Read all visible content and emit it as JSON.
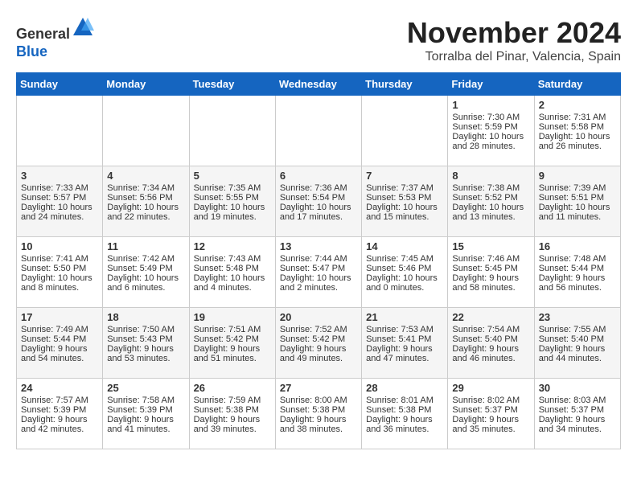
{
  "header": {
    "logo_line1": "General",
    "logo_line2": "Blue",
    "month_title": "November 2024",
    "location": "Torralba del Pinar, Valencia, Spain"
  },
  "weekdays": [
    "Sunday",
    "Monday",
    "Tuesday",
    "Wednesday",
    "Thursday",
    "Friday",
    "Saturday"
  ],
  "weeks": [
    [
      {
        "day": "",
        "data": ""
      },
      {
        "day": "",
        "data": ""
      },
      {
        "day": "",
        "data": ""
      },
      {
        "day": "",
        "data": ""
      },
      {
        "day": "",
        "data": ""
      },
      {
        "day": "1",
        "data": "Sunrise: 7:30 AM\nSunset: 5:59 PM\nDaylight: 10 hours and 28 minutes."
      },
      {
        "day": "2",
        "data": "Sunrise: 7:31 AM\nSunset: 5:58 PM\nDaylight: 10 hours and 26 minutes."
      }
    ],
    [
      {
        "day": "3",
        "data": "Sunrise: 7:33 AM\nSunset: 5:57 PM\nDaylight: 10 hours and 24 minutes."
      },
      {
        "day": "4",
        "data": "Sunrise: 7:34 AM\nSunset: 5:56 PM\nDaylight: 10 hours and 22 minutes."
      },
      {
        "day": "5",
        "data": "Sunrise: 7:35 AM\nSunset: 5:55 PM\nDaylight: 10 hours and 19 minutes."
      },
      {
        "day": "6",
        "data": "Sunrise: 7:36 AM\nSunset: 5:54 PM\nDaylight: 10 hours and 17 minutes."
      },
      {
        "day": "7",
        "data": "Sunrise: 7:37 AM\nSunset: 5:53 PM\nDaylight: 10 hours and 15 minutes."
      },
      {
        "day": "8",
        "data": "Sunrise: 7:38 AM\nSunset: 5:52 PM\nDaylight: 10 hours and 13 minutes."
      },
      {
        "day": "9",
        "data": "Sunrise: 7:39 AM\nSunset: 5:51 PM\nDaylight: 10 hours and 11 minutes."
      }
    ],
    [
      {
        "day": "10",
        "data": "Sunrise: 7:41 AM\nSunset: 5:50 PM\nDaylight: 10 hours and 8 minutes."
      },
      {
        "day": "11",
        "data": "Sunrise: 7:42 AM\nSunset: 5:49 PM\nDaylight: 10 hours and 6 minutes."
      },
      {
        "day": "12",
        "data": "Sunrise: 7:43 AM\nSunset: 5:48 PM\nDaylight: 10 hours and 4 minutes."
      },
      {
        "day": "13",
        "data": "Sunrise: 7:44 AM\nSunset: 5:47 PM\nDaylight: 10 hours and 2 minutes."
      },
      {
        "day": "14",
        "data": "Sunrise: 7:45 AM\nSunset: 5:46 PM\nDaylight: 10 hours and 0 minutes."
      },
      {
        "day": "15",
        "data": "Sunrise: 7:46 AM\nSunset: 5:45 PM\nDaylight: 9 hours and 58 minutes."
      },
      {
        "day": "16",
        "data": "Sunrise: 7:48 AM\nSunset: 5:44 PM\nDaylight: 9 hours and 56 minutes."
      }
    ],
    [
      {
        "day": "17",
        "data": "Sunrise: 7:49 AM\nSunset: 5:44 PM\nDaylight: 9 hours and 54 minutes."
      },
      {
        "day": "18",
        "data": "Sunrise: 7:50 AM\nSunset: 5:43 PM\nDaylight: 9 hours and 53 minutes."
      },
      {
        "day": "19",
        "data": "Sunrise: 7:51 AM\nSunset: 5:42 PM\nDaylight: 9 hours and 51 minutes."
      },
      {
        "day": "20",
        "data": "Sunrise: 7:52 AM\nSunset: 5:42 PM\nDaylight: 9 hours and 49 minutes."
      },
      {
        "day": "21",
        "data": "Sunrise: 7:53 AM\nSunset: 5:41 PM\nDaylight: 9 hours and 47 minutes."
      },
      {
        "day": "22",
        "data": "Sunrise: 7:54 AM\nSunset: 5:40 PM\nDaylight: 9 hours and 46 minutes."
      },
      {
        "day": "23",
        "data": "Sunrise: 7:55 AM\nSunset: 5:40 PM\nDaylight: 9 hours and 44 minutes."
      }
    ],
    [
      {
        "day": "24",
        "data": "Sunrise: 7:57 AM\nSunset: 5:39 PM\nDaylight: 9 hours and 42 minutes."
      },
      {
        "day": "25",
        "data": "Sunrise: 7:58 AM\nSunset: 5:39 PM\nDaylight: 9 hours and 41 minutes."
      },
      {
        "day": "26",
        "data": "Sunrise: 7:59 AM\nSunset: 5:38 PM\nDaylight: 9 hours and 39 minutes."
      },
      {
        "day": "27",
        "data": "Sunrise: 8:00 AM\nSunset: 5:38 PM\nDaylight: 9 hours and 38 minutes."
      },
      {
        "day": "28",
        "data": "Sunrise: 8:01 AM\nSunset: 5:38 PM\nDaylight: 9 hours and 36 minutes."
      },
      {
        "day": "29",
        "data": "Sunrise: 8:02 AM\nSunset: 5:37 PM\nDaylight: 9 hours and 35 minutes."
      },
      {
        "day": "30",
        "data": "Sunrise: 8:03 AM\nSunset: 5:37 PM\nDaylight: 9 hours and 34 minutes."
      }
    ]
  ]
}
